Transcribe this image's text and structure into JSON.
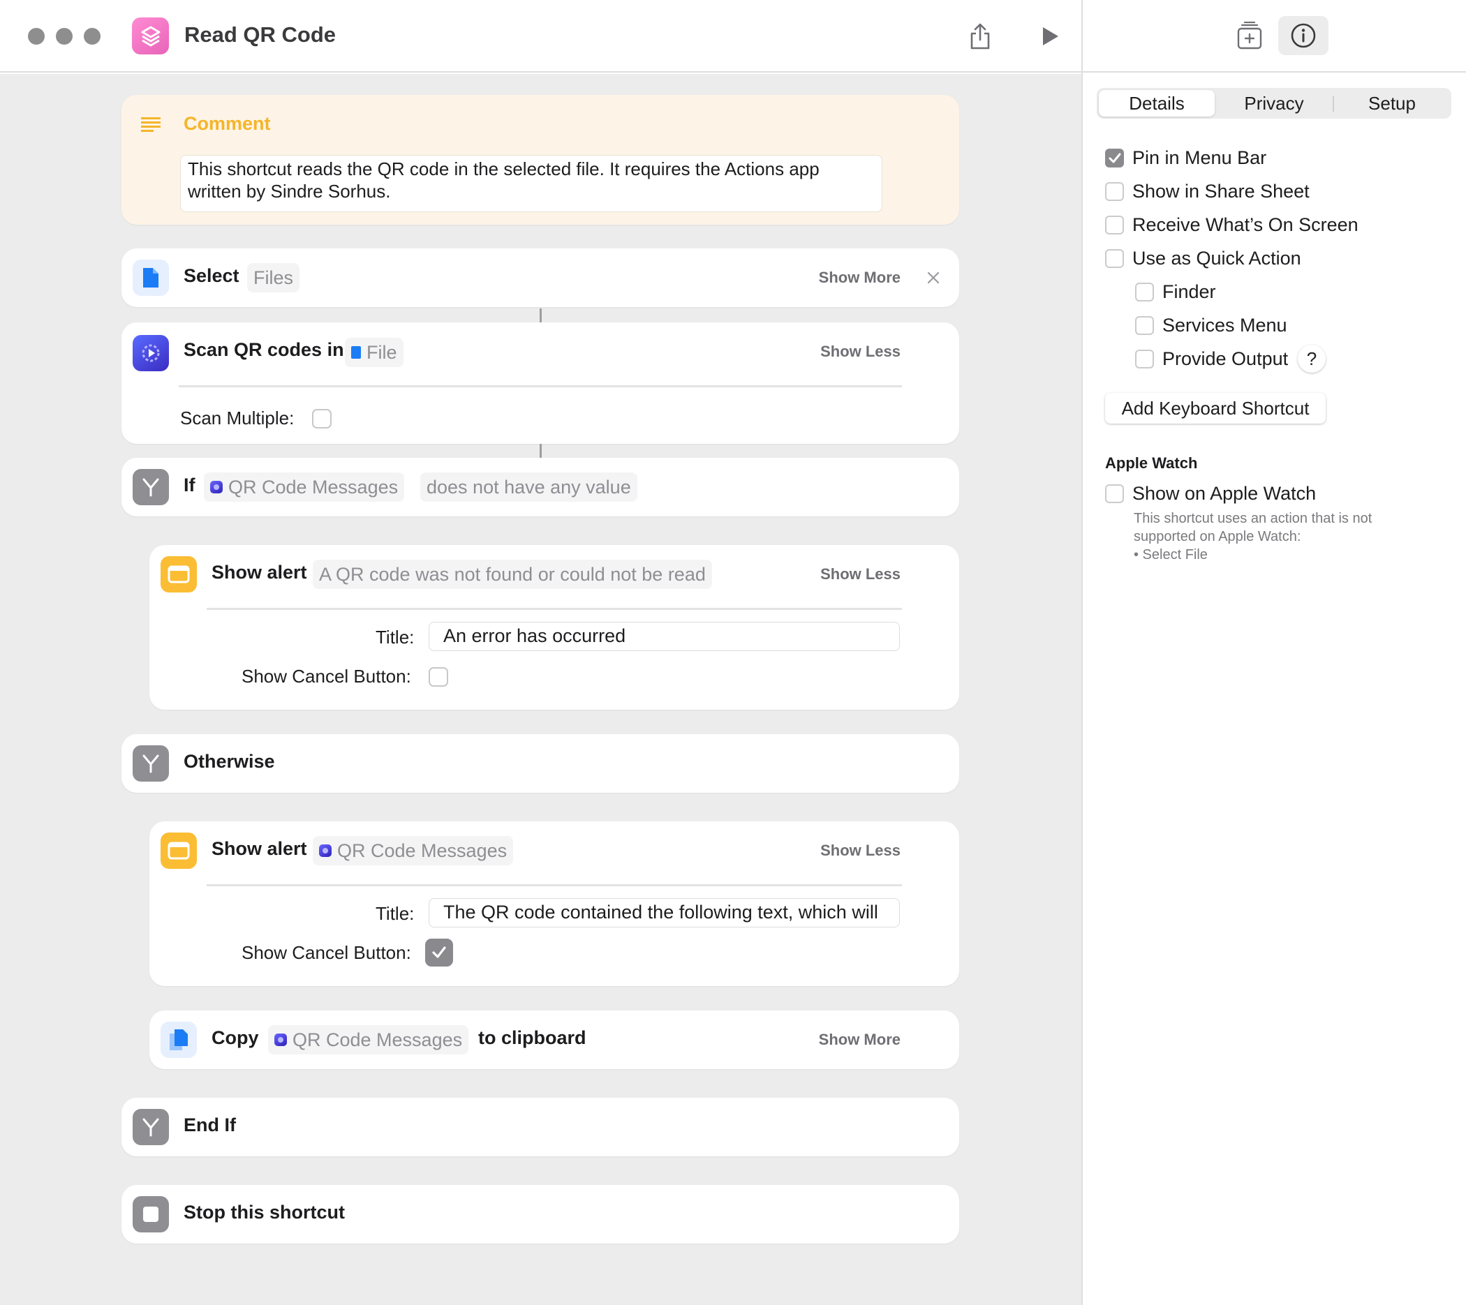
{
  "window": {
    "title": "Read QR Code"
  },
  "comment": {
    "label": "Comment",
    "text": "This shortcut reads the QR code in the selected file. It requires the Actions app written by Sindre Sorhus."
  },
  "actions": {
    "select": {
      "verb": "Select",
      "token": "Files",
      "toggle": "Show More"
    },
    "scan": {
      "verb": "Scan QR codes in",
      "token": "File",
      "toggle": "Show Less",
      "param_label": "Scan Multiple:",
      "param_checked": false
    },
    "if": {
      "verb": "If",
      "token": "QR Code Messages",
      "condition": "does not have any value"
    },
    "alert1": {
      "verb": "Show alert",
      "token": "A QR code was not found or could not be read",
      "toggle": "Show Less",
      "title_label": "Title:",
      "title_value": "An error has occurred",
      "cancel_label": "Show Cancel Button:",
      "cancel_checked": false
    },
    "otherwise": {
      "verb": "Otherwise"
    },
    "alert2": {
      "verb": "Show alert",
      "token": "QR Code Messages",
      "toggle": "Show Less",
      "title_label": "Title:",
      "title_value": "The QR code contained the following text, which will",
      "cancel_label": "Show Cancel Button:",
      "cancel_checked": true
    },
    "copy": {
      "verb": "Copy",
      "token": "QR Code Messages",
      "suffix": "to clipboard",
      "toggle": "Show More"
    },
    "endif": {
      "verb": "End If"
    },
    "stop": {
      "verb": "Stop this shortcut"
    }
  },
  "sidebar": {
    "tabs": [
      "Details",
      "Privacy",
      "Setup"
    ],
    "active_tab": "Details",
    "options": {
      "pin_menu_bar": {
        "label": "Pin in Menu Bar",
        "checked": true
      },
      "share_sheet": {
        "label": "Show in Share Sheet",
        "checked": false
      },
      "whats_on_screen": {
        "label": "Receive What’s On Screen",
        "checked": false
      },
      "quick_action": {
        "label": "Use as Quick Action",
        "checked": false
      },
      "finder": {
        "label": "Finder",
        "checked": false
      },
      "services_menu": {
        "label": "Services Menu",
        "checked": false
      },
      "provide_output": {
        "label": "Provide Output",
        "checked": false
      }
    },
    "help_glyph": "?",
    "keyboard_button": "Add Keyboard Shortcut",
    "apple_watch": {
      "heading": "Apple Watch",
      "label": "Show on Apple Watch",
      "checked": false,
      "note_lines": [
        "This shortcut uses an action that is not",
        "supported on Apple Watch:",
        "• Select File"
      ]
    }
  },
  "icons": {
    "app": "shortcuts-app-icon",
    "share": "share-icon",
    "run": "play-icon",
    "library": "action-library-icon",
    "info": "info-icon"
  }
}
